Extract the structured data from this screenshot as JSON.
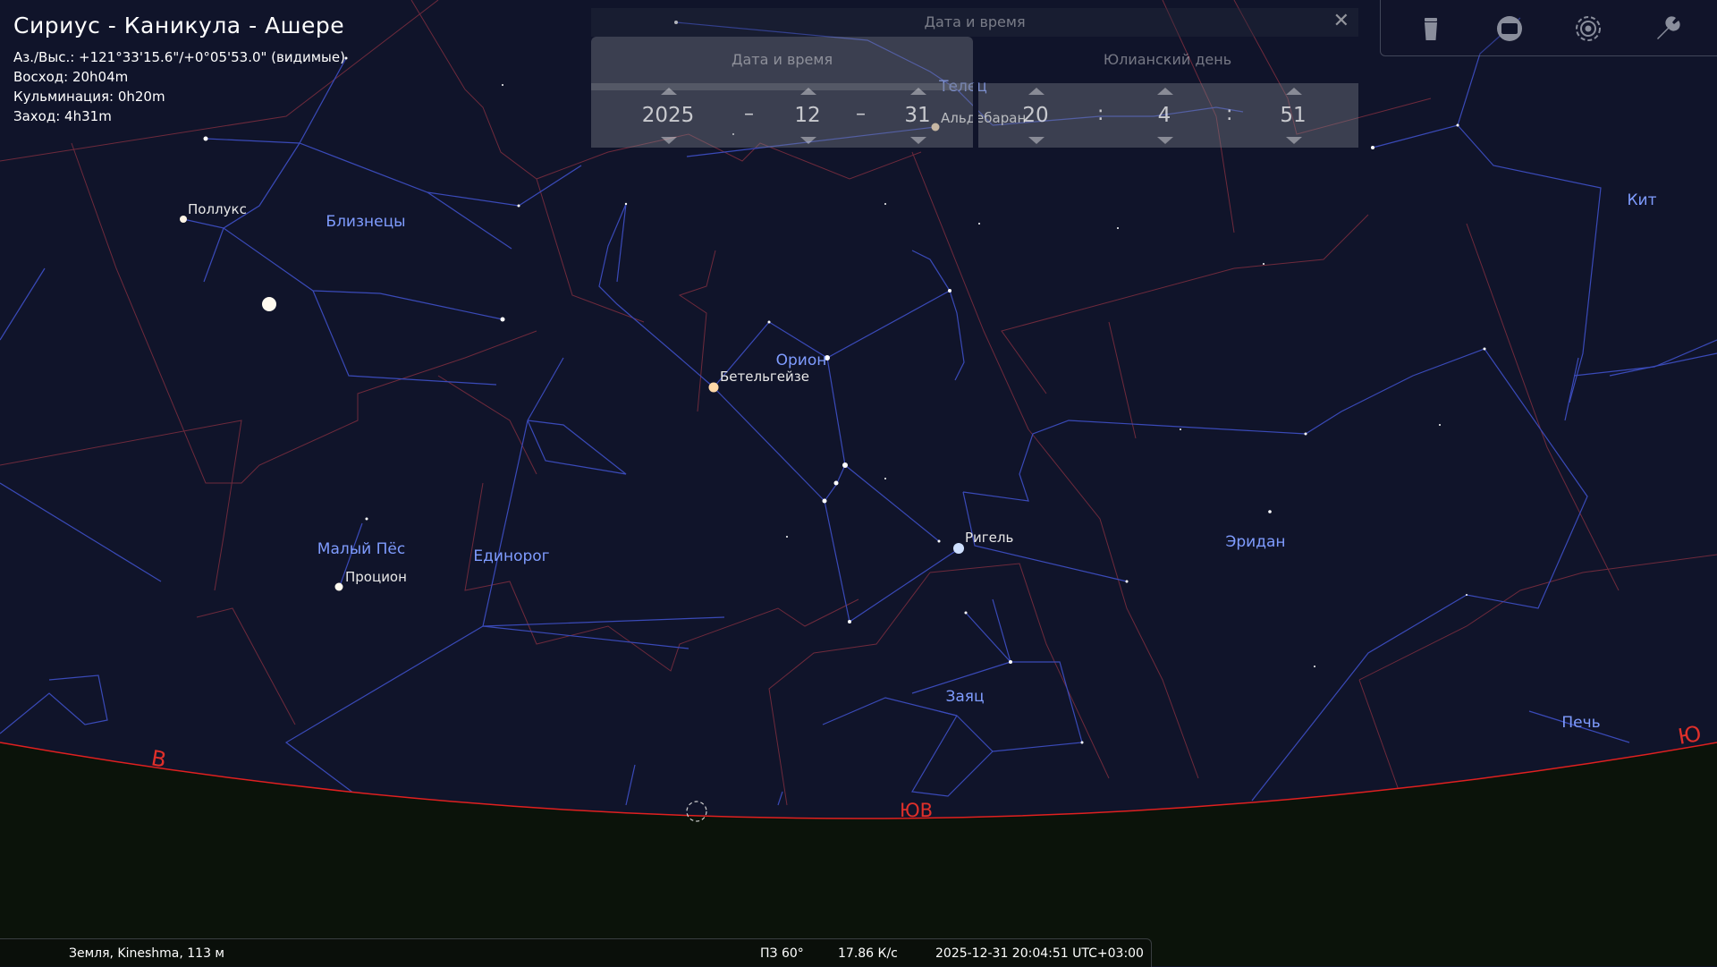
{
  "object_info": {
    "title": "Сириус - Каникула - Ашере",
    "azalt": "Аз./Выс.: +121°33'15.6\"/+0°05'53.0\" (видимые)",
    "rise": "Восход: 20h04m",
    "transit": "Кульминация: 0h20m",
    "set": "Заход: 4h31m"
  },
  "datetime_dialog": {
    "title": "Дата и время",
    "close_icon": "close-icon",
    "tabs": [
      {
        "label": "Дата и время",
        "active": true
      },
      {
        "label": "Юлианский день",
        "active": false
      }
    ],
    "year": "2025",
    "month": "12",
    "day": "31",
    "hour": "20",
    "minute": "4",
    "second": "51",
    "date_separator": "–",
    "time_separator": ":"
  },
  "toolbar": {
    "icons": [
      "trash-can-icon",
      "screen-icon",
      "target-icon",
      "wrench-icon"
    ]
  },
  "constellations": {
    "gemini": "Близнецы",
    "orion": "Орион",
    "canis_minor": "Малый Пёс",
    "monoceros": "Единорог",
    "lepus": "Заяц",
    "eridanus": "Эридан",
    "cetus": "Кит",
    "fornax": "Печь",
    "taurus": "Телец"
  },
  "stars": {
    "pollux": "Поллукс",
    "betelgeuse": "Бетельгейзе",
    "rigel": "Ригель",
    "procyon": "Процион",
    "aldebaran": "Альдебаран"
  },
  "cardinal": {
    "east": "В",
    "southeast": "ЮВ",
    "south": "Ю"
  },
  "status_bar": {
    "location": "Земля, Kineshma, 113 м",
    "fov": "ПЗ 60°",
    "fps": "17.86 К/с",
    "datetime": "2025-12-31 20:04:51 UTC+03:00"
  },
  "colors": {
    "sky": "#10142a",
    "ground": "#0b130a",
    "horizon": "#e02020",
    "constellation_line": "#3a4ab8",
    "boundary": "#6e2a3c",
    "constellation_label": "#7f9cff",
    "star_label": "#e8e8e8",
    "cardinal": "#e0302a"
  }
}
